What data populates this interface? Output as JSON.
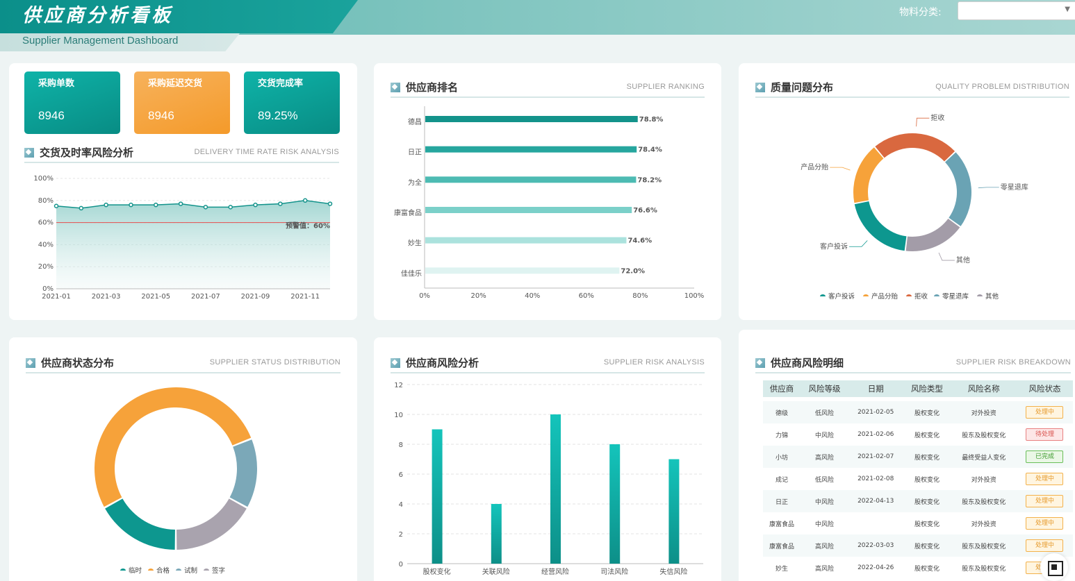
{
  "header": {
    "title": "供应商分析看板",
    "subtitle": "Supplier Management Dashboard",
    "filter_label": "物料分类:",
    "filter_value": ""
  },
  "kpis": [
    {
      "label": "采购单数",
      "value": "8946"
    },
    {
      "label": "采购延迟交货",
      "value": "8946"
    },
    {
      "label": "交货完成率",
      "value": "89.25%"
    }
  ],
  "panels": {
    "delivery": {
      "title": "交货及时率风险分析",
      "en": "DELIVERY TIME RATE RISK ANALYSIS"
    },
    "ranking": {
      "title": "供应商排名",
      "en": "SUPPLIER RANKING"
    },
    "quality": {
      "title": "质量问题分布",
      "en": "QUALITY PROBLEM DISTRIBUTION"
    },
    "status": {
      "title": "供应商状态分布",
      "en": "SUPPLIER STATUS DISTRIBUTION"
    },
    "risk": {
      "title": "供应商风险分析",
      "en": "SUPPLIER RISK ANALYSIS"
    },
    "detail": {
      "title": "供应商风险明细",
      "en": "SUPPLIER RISK BREAKDOWN"
    }
  },
  "chart_data": [
    {
      "id": "delivery",
      "type": "area",
      "x": [
        "2021-01",
        "2021-02",
        "2021-03",
        "2021-04",
        "2021-05",
        "2021-06",
        "2021-07",
        "2021-08",
        "2021-09",
        "2021-10",
        "2021-11",
        "2021-12"
      ],
      "xticks": [
        "2021-01",
        "2021-03",
        "2021-05",
        "2021-07",
        "2021-09",
        "2021-11"
      ],
      "values": [
        75,
        73,
        76,
        76,
        76,
        77,
        74,
        74,
        76,
        77,
        80,
        77
      ],
      "ylim": [
        0,
        100
      ],
      "yticks": [
        "0%",
        "20%",
        "40%",
        "60%",
        "80%",
        "100%"
      ],
      "threshold": 60,
      "threshold_label": "预警值：60%",
      "colors": {
        "line": "#13938b",
        "threshold": "#e74c4c"
      }
    },
    {
      "id": "ranking",
      "type": "bar",
      "orientation": "horizontal",
      "categories": [
        "德昌",
        "日正",
        "为全",
        "康富食品",
        "妙生",
        "佳佳乐"
      ],
      "values": [
        78.8,
        78.4,
        78.2,
        76.6,
        74.6,
        72.0
      ],
      "labels": [
        "78.8%",
        "78.4%",
        "78.2%",
        "76.6%",
        "74.6%",
        "72.0%"
      ],
      "xlim": [
        0,
        100
      ],
      "xticks": [
        "0%",
        "20%",
        "40%",
        "60%",
        "80%",
        "100%"
      ],
      "colors": [
        "#13938b",
        "#26a69e",
        "#4dbbb3",
        "#7bd0c9",
        "#abe2dd",
        "#dff3f1"
      ]
    },
    {
      "id": "quality",
      "type": "pie",
      "donut": true,
      "categories": [
        "客户投诉",
        "产品分贻",
        "拒收",
        "零星退库",
        "其他"
      ],
      "values": [
        20,
        17,
        24,
        22,
        17
      ],
      "colors": [
        "#0d978f",
        "#f6a23a",
        "#d9683f",
        "#6aa3b4",
        "#a39ca8"
      ]
    },
    {
      "id": "status",
      "type": "pie",
      "donut": true,
      "categories": [
        "临时",
        "合格",
        "试制",
        "签字"
      ],
      "values": [
        17,
        52,
        14,
        17
      ],
      "colors": [
        "#0d978f",
        "#f6a23a",
        "#7ba8b8",
        "#a9a3ae"
      ]
    },
    {
      "id": "risk",
      "type": "bar",
      "categories": [
        "股权变化",
        "关联风险",
        "经营风险",
        "司法风险",
        "失信风险"
      ],
      "values": [
        9,
        4,
        10,
        8,
        7
      ],
      "ylim": [
        0,
        12
      ],
      "yticks": [
        "0",
        "2",
        "4",
        "6",
        "8",
        "10",
        "12"
      ],
      "colors": {
        "top": "#14c4bb",
        "bottom": "#0d8f88"
      }
    }
  ],
  "detail_table": {
    "headers": [
      "供应商",
      "风险等级",
      "日期",
      "风险类型",
      "风险名称",
      "风险状态"
    ],
    "rows": [
      [
        "德级",
        "低风险",
        "2021-02-05",
        "股权变化",
        "对外投资",
        "处理中"
      ],
      [
        "力锦",
        "中风险",
        "2021-02-06",
        "股权变化",
        "股东及股权变化",
        "待处理"
      ],
      [
        "小坊",
        "高风险",
        "2021-02-07",
        "股权变化",
        "最终受益人变化",
        "已完成"
      ],
      [
        "成记",
        "低风险",
        "2021-02-08",
        "股权变化",
        "对外投资",
        "处理中"
      ],
      [
        "日正",
        "中风险",
        "2022-04-13",
        "股权变化",
        "股东及股权变化",
        "处理中"
      ],
      [
        "康富食品",
        "中风险",
        "",
        "股权变化",
        "对外投资",
        "处理中"
      ],
      [
        "康富食品",
        "高风险",
        "2022-03-03",
        "股权变化",
        "股东及股权变化",
        "处理中"
      ],
      [
        "妙生",
        "高风险",
        "2022-04-26",
        "股权变化",
        "股东及股权变化",
        "处理中"
      ]
    ]
  }
}
